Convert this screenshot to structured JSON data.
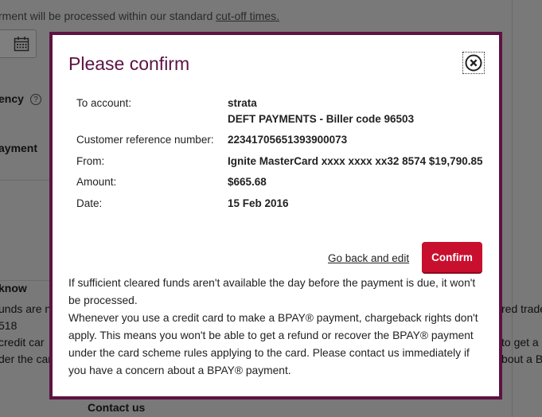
{
  "background": {
    "notice_prefix": "rment will be processed within our standard ",
    "notice_link": "cut-off times.",
    "frequency_label": "ency",
    "help_icon_glyph": "?",
    "payment_label": "ayment",
    "know_heading": "know",
    "left_line1": "unds are n",
    "left_line2": "518",
    "left_line3": "credit car",
    "left_line4": "der the car",
    "right_line1": "red trade",
    "right_line2": "to get a r",
    "right_line3": "bout a B",
    "contact_us": "Contact us"
  },
  "modal": {
    "title": "Please confirm",
    "close_icon": "close-circle-icon",
    "rows": [
      {
        "label": "To account:",
        "value": "strata",
        "value2": "DEFT PAYMENTS - Biller code 96503"
      },
      {
        "label": "Customer reference number:",
        "value": "22341705651393900073"
      },
      {
        "label": "From:",
        "value": "Ignite MasterCard xxxx xxxx xx32 8574 $19,790.85"
      },
      {
        "label": "Amount:",
        "value": "$665.68"
      },
      {
        "label": "Date:",
        "value": "15 Feb 2016"
      }
    ],
    "go_back_label": "Go back and edit",
    "confirm_label": "Confirm",
    "info1": "If sufficient cleared funds aren't available the day before the payment is due, it won't be processed.",
    "info2": "Whenever you use a credit card to make a BPAY® payment, chargeback rights don't apply. This means you won't be able to get a refund or recover the BPAY® payment under the card scheme rules applying to the card. Please contact us immediately if you have a concern about a BPAY® payment."
  },
  "colors": {
    "brand": "#5d1342",
    "confirm": "#c8102e"
  }
}
